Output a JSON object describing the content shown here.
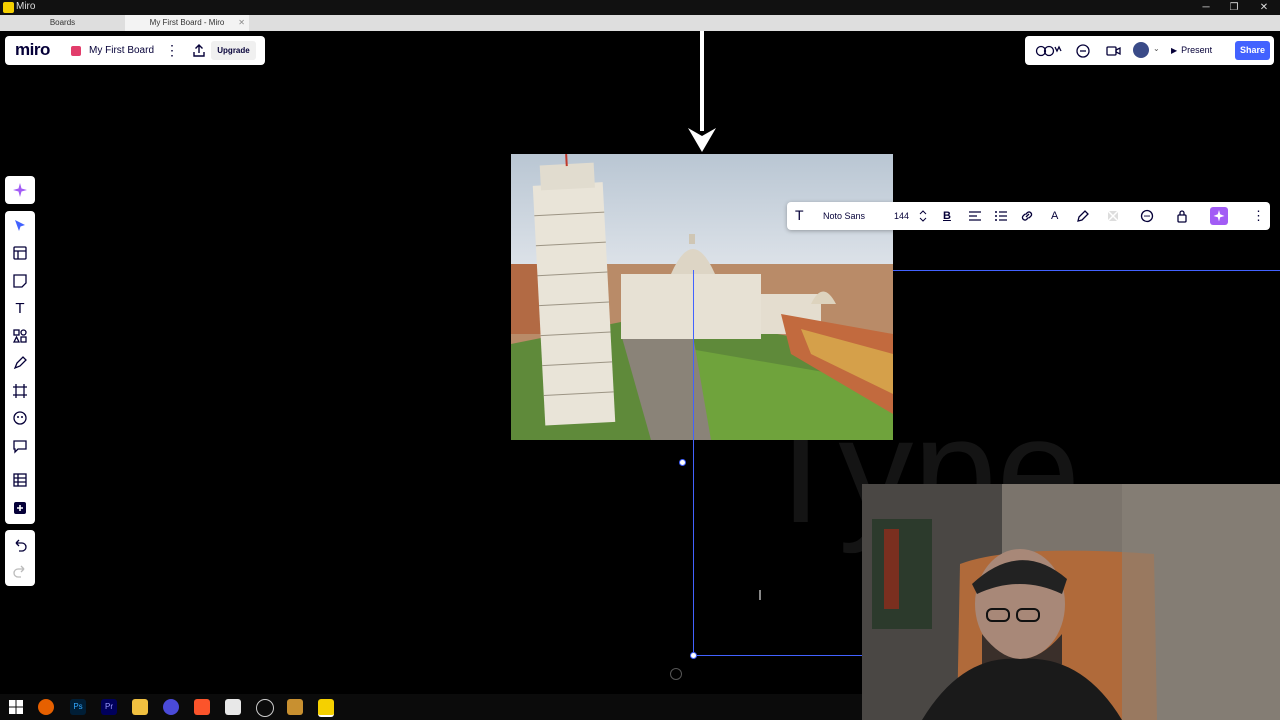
{
  "window": {
    "title": "Miro",
    "controls": [
      "─",
      "❐",
      "✕"
    ]
  },
  "browser": {
    "tabs": [
      {
        "label": "Boards",
        "active": false
      },
      {
        "label": "My First Board - Miro",
        "active": true,
        "close": "✕"
      }
    ]
  },
  "header": {
    "logo": "miro",
    "board_name": "My First Board",
    "more_icon": "⋮",
    "upgrade_label": "Upgrade"
  },
  "topright": {
    "present_label": "Present",
    "share_label": "Share",
    "caret": "⌄",
    "present_icon": "▶"
  },
  "toolbar": {
    "tools": [
      "ai-sparkle",
      "select",
      "templates",
      "sticky-note",
      "text",
      "shapes",
      "pen",
      "frame",
      "stickers",
      "comment",
      "table",
      "more"
    ],
    "text_tool_glyph": "T"
  },
  "text_toolbar": {
    "font": "Noto Sans",
    "size": "144",
    "text_icon": "T",
    "bold_icon": "B",
    "color_icon": "A",
    "more_icon": "⋮"
  },
  "canvas": {
    "ghost_text": "Type"
  },
  "colors": {
    "accent": "#4262ff",
    "brand_pink": "#e23d6b",
    "ai_purple": "#a25cf5"
  }
}
